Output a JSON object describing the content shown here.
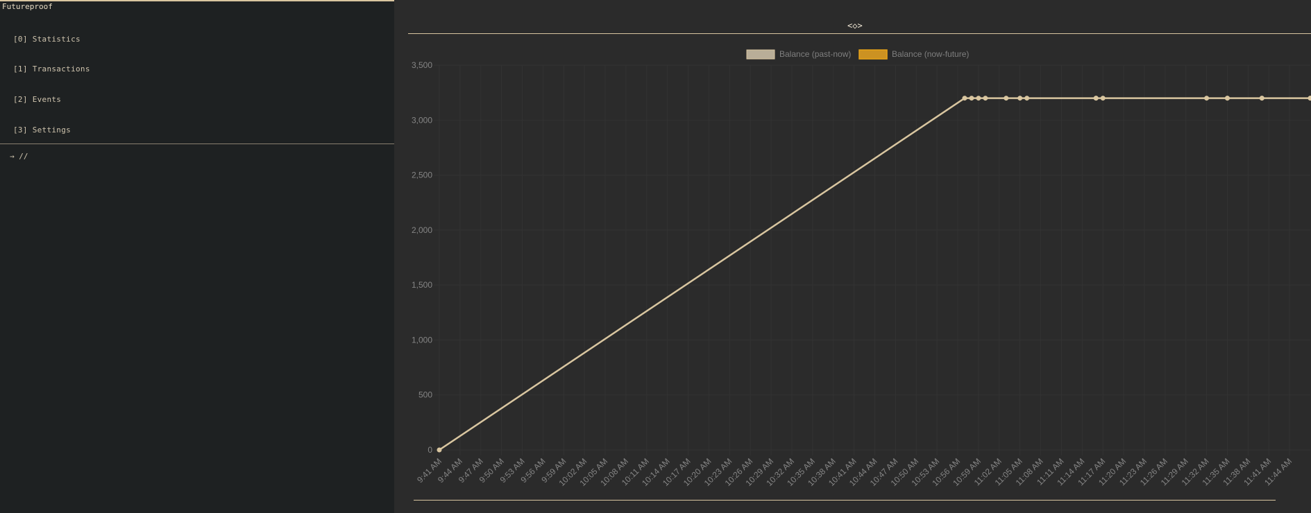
{
  "app": {
    "title": "Futureproof"
  },
  "menu": [
    {
      "label": "[0] Statistics"
    },
    {
      "label": "[1] Transactions"
    },
    {
      "label": "[2] Events"
    },
    {
      "label": "[3] Settings"
    }
  ],
  "command": {
    "text": "→ //"
  },
  "nav": {
    "glyph": "<◇>"
  },
  "colors": {
    "past_series": "#d9c6a0",
    "past_legend_fill": "#b9ae98",
    "future_series": "#e8a317",
    "future_legend_fill": "#cc9222",
    "grid": "#333333"
  },
  "chart_data": {
    "type": "line",
    "legend_position": "top-center",
    "grid": true,
    "series": [
      {
        "name": "Balance (past-now)",
        "points": [
          {
            "x": "9:41 AM",
            "y": 0
          },
          {
            "x": "10:57 AM",
            "y": 3200
          },
          {
            "x": "10:58 AM",
            "y": 3200
          },
          {
            "x": "10:59 AM",
            "y": 3200
          },
          {
            "x": "11:00 AM",
            "y": 3200
          },
          {
            "x": "11:03 AM",
            "y": 3200
          },
          {
            "x": "11:05 AM",
            "y": 3200
          },
          {
            "x": "11:06 AM",
            "y": 3200
          },
          {
            "x": "11:16 AM",
            "y": 3200
          },
          {
            "x": "11:16 AM",
            "y": 3200
          },
          {
            "x": "11:17 AM",
            "y": 3200
          },
          {
            "x": "11:32 AM",
            "y": 3200
          },
          {
            "x": "11:35 AM",
            "y": 3200
          },
          {
            "x": "11:35 AM",
            "y": 3200
          },
          {
            "x": "11:40 AM",
            "y": 3200
          },
          {
            "x": "11:40 AM",
            "y": 3200
          },
          {
            "x": "11:47 AM",
            "y": 3200
          },
          {
            "x": "11:47 AM",
            "y": 3200
          }
        ]
      },
      {
        "name": "Balance (now-future)",
        "points": []
      }
    ],
    "x_ticks": [
      "9:41 AM",
      "9:44 AM",
      "9:47 AM",
      "9:50 AM",
      "9:53 AM",
      "9:56 AM",
      "9:59 AM",
      "10:02 AM",
      "10:05 AM",
      "10:08 AM",
      "10:11 AM",
      "10:14 AM",
      "10:17 AM",
      "10:20 AM",
      "10:23 AM",
      "10:26 AM",
      "10:29 AM",
      "10:32 AM",
      "10:35 AM",
      "10:38 AM",
      "10:41 AM",
      "10:44 AM",
      "10:47 AM",
      "10:50 AM",
      "10:53 AM",
      "10:56 AM",
      "10:59 AM",
      "11:02 AM",
      "11:05 AM",
      "11:08 AM",
      "11:11 AM",
      "11:14 AM",
      "11:17 AM",
      "11:20 AM",
      "11:23 AM",
      "11:26 AM",
      "11:29 AM",
      "11:32 AM",
      "11:35 AM",
      "11:38 AM",
      "11:41 AM",
      "11:44 AM"
    ],
    "y_ticks": [
      "0",
      "500",
      "1,000",
      "1,500",
      "2,000",
      "2,500",
      "3,000",
      "3,500"
    ],
    "ylim": [
      0,
      3500
    ],
    "xlim": [
      "9:41 AM",
      "11:47 AM"
    ]
  }
}
